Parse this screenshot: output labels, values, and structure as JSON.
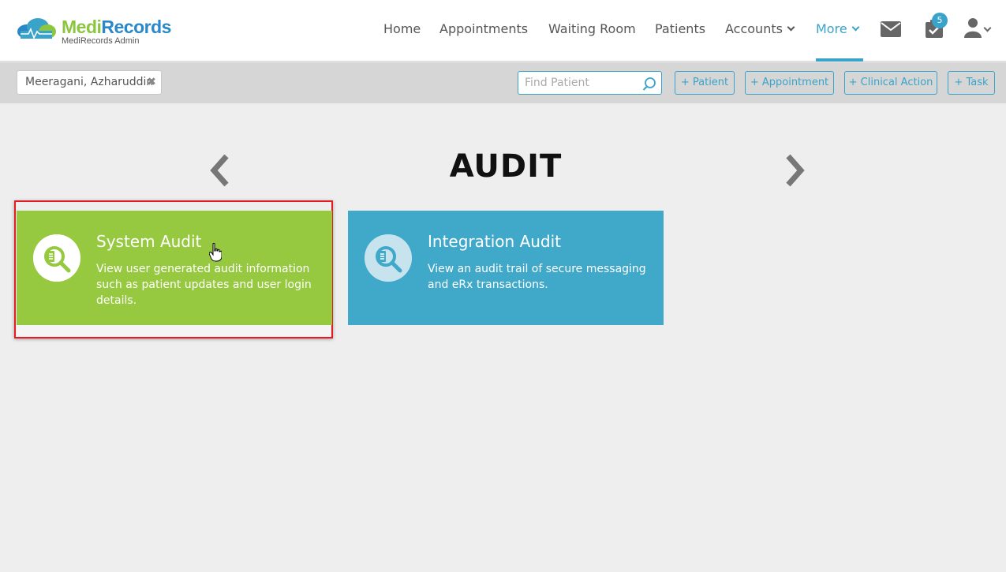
{
  "brand": {
    "name_part1": "Medi",
    "name_part2": "Records",
    "subtitle": "MediRecords Admin",
    "colors": {
      "green": "#8cc63f",
      "blue": "#2a87c9"
    }
  },
  "nav": {
    "items": [
      {
        "label": "Home"
      },
      {
        "label": "Appointments"
      },
      {
        "label": "Waiting Room"
      },
      {
        "label": "Patients"
      },
      {
        "label": "Accounts",
        "dropdown": true
      },
      {
        "label": "More",
        "dropdown": true,
        "active": true
      }
    ],
    "icons": [
      "mail-icon",
      "tasks-icon",
      "user-icon"
    ],
    "task_badge": "5",
    "accent": "#3aa3c9"
  },
  "toolbar": {
    "patient_name": "Meeragani, Azharuddin",
    "find_placeholder": "Find Patient",
    "buttons": [
      "+ Patient",
      "+ Appointment",
      "+ Clinical Action",
      "+ Task"
    ]
  },
  "page": {
    "title": "AUDIT"
  },
  "cards": [
    {
      "title": "System Audit",
      "description": "View user generated audit information such as patient updates and user login details.",
      "color": "#96c93f",
      "highlighted": true
    },
    {
      "title": "Integration Audit",
      "description": "View an audit trail of secure messaging and eRx transactions.",
      "color": "#40a8c9",
      "highlighted": false
    }
  ]
}
